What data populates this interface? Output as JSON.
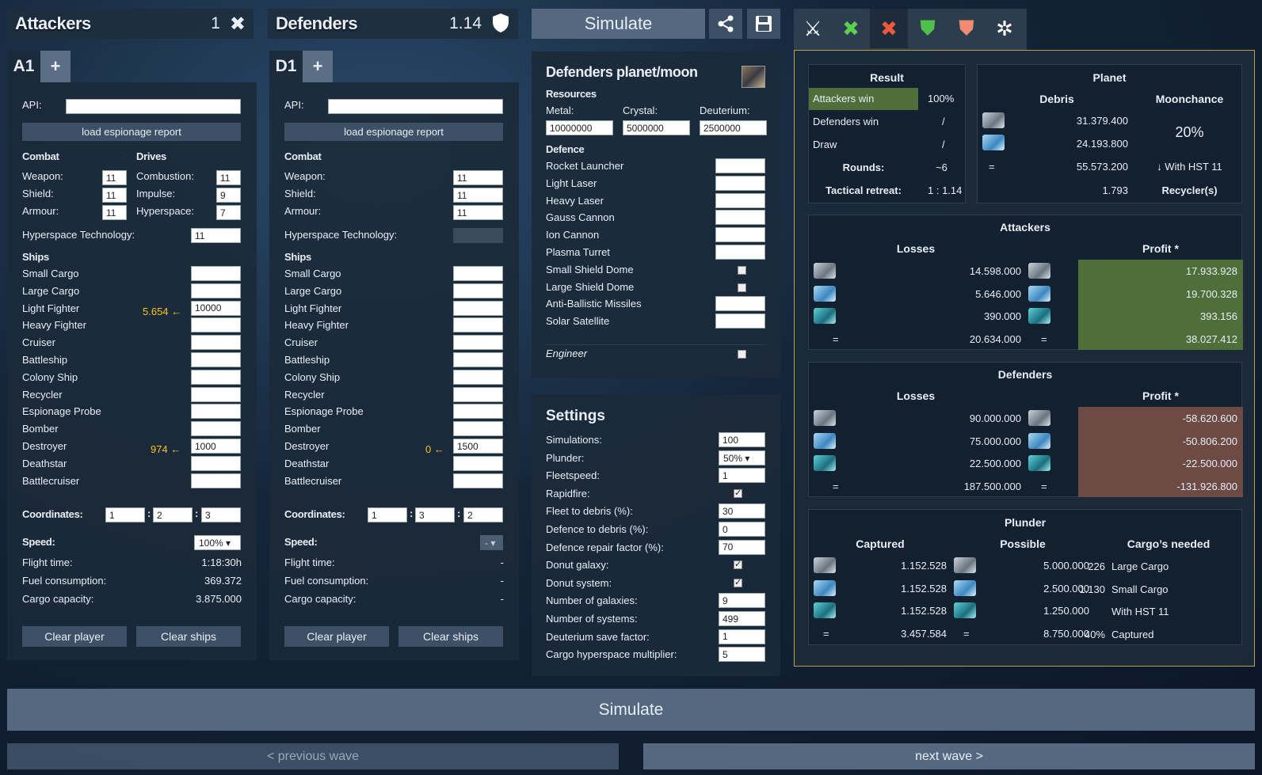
{
  "attackers": {
    "title": "Attackers",
    "value": "1",
    "tab": "A1",
    "api_label": "API:",
    "load_label": "load espionage report",
    "combat": "Combat",
    "drives": "Drives",
    "weapon": "Weapon:",
    "shield": "Shield:",
    "armour": "Armour:",
    "weapon_v": "11",
    "shield_v": "11",
    "armour_v": "11",
    "combustion": "Combustion:",
    "impulse": "Impulse:",
    "hyperspace": "Hyperspace:",
    "combustion_v": "11",
    "impulse_v": "9",
    "hyperspace_v": "7",
    "hst": "Hyperspace Technology:",
    "hst_v": "11",
    "ships": "Ships",
    "lf_hint": "5.654 ←",
    "lf_v": "10000",
    "ds_hint": "974 ←",
    "ds_v": "1000",
    "coords": "Coordinates:",
    "c1": "1",
    "c2": "2",
    "c3": "3",
    "speed": "Speed:",
    "speed_v": "100%",
    "flight": "Flight time:",
    "flight_v": "1:18:30h",
    "fuel": "Fuel consumption:",
    "fuel_v": "369.372",
    "cargo": "Cargo capacity:",
    "cargo_v": "3.875.000",
    "clear_player": "Clear player",
    "clear_ships": "Clear ships"
  },
  "defenders": {
    "title": "Defenders",
    "value": "1.14",
    "tab": "D1",
    "api_label": "API:",
    "load_label": "load espionage report",
    "combat": "Combat",
    "weapon": "Weapon:",
    "shield": "Shield:",
    "armour": "Armour:",
    "weapon_v": "11",
    "shield_v": "11",
    "armour_v": "11",
    "hst": "Hyperspace Technology:",
    "ships": "Ships",
    "ds_hint": "0 ←",
    "ds_v": "1500",
    "coords": "Coordinates:",
    "c1": "1",
    "c2": "3",
    "c3": "2",
    "speed": "Speed:",
    "speed_v": "-",
    "flight": "Flight time:",
    "flight_v": "-",
    "fuel": "Fuel consumption:",
    "fuel_v": "-",
    "cargo": "Cargo capacity:",
    "cargo_v": "-",
    "clear_player": "Clear player",
    "clear_ships": "Clear ships"
  },
  "ships": [
    "Small Cargo",
    "Large Cargo",
    "Light Fighter",
    "Heavy Fighter",
    "Cruiser",
    "Battleship",
    "Colony Ship",
    "Recycler",
    "Espionage Probe",
    "Bomber",
    "Destroyer",
    "Deathstar",
    "Battlecruiser"
  ],
  "top": {
    "simulate": "Simulate"
  },
  "planet": {
    "title": "Defenders planet/moon",
    "resources": "Resources",
    "metal": "Metal:",
    "crystal": "Crystal:",
    "deuterium": "Deuterium:",
    "metal_v": "10000000",
    "crystal_v": "5000000",
    "deut_v": "2500000",
    "defence": "Defence",
    "items": [
      "Rocket Launcher",
      "Light Laser",
      "Heavy Laser",
      "Gauss Cannon",
      "Ion Cannon",
      "Plasma Turret",
      "Small Shield Dome",
      "Large Shield Dome",
      "Anti-Ballistic Missiles",
      "Solar Satellite"
    ],
    "engineer": "Engineer"
  },
  "settings": {
    "title": "Settings",
    "rows": [
      {
        "label": "Simulations:",
        "value": "100"
      },
      {
        "label": "Plunder:",
        "value": "50%"
      },
      {
        "label": "Fleetspeed:",
        "value": "1"
      },
      {
        "label": "Rapidfire:",
        "value": ""
      },
      {
        "label": "Fleet to debris (%):",
        "value": "30"
      },
      {
        "label": "Defence to debris (%):",
        "value": "0"
      },
      {
        "label": "Defence repair factor (%):",
        "value": "70"
      },
      {
        "label": "Donut galaxy:",
        "value": ""
      },
      {
        "label": "Donut system:",
        "value": ""
      },
      {
        "label": "Number of galaxies:",
        "value": "9"
      },
      {
        "label": "Number of systems:",
        "value": "499"
      },
      {
        "label": "Deuterium save factor:",
        "value": "1"
      },
      {
        "label": "Cargo hyperspace multiplier:",
        "value": "5"
      }
    ]
  },
  "result": {
    "title": "Result",
    "att_win": "Attackers win",
    "att_win_v": "100%",
    "def_win": "Defenders win",
    "def_win_v": "/",
    "draw": "Draw",
    "draw_v": "/",
    "rounds": "Rounds:",
    "rounds_v": "~6",
    "retreat": "Tactical retreat:",
    "retreat_v": "1 : 1.14"
  },
  "planet_res": {
    "title": "Planet",
    "debris": "Debris",
    "moonchance": "Moonchance",
    "metal": "31.379.400",
    "crystal": "24.193.800",
    "eq": "=",
    "total": "55.573.200",
    "moon_v": "20%",
    "hst": "↓ With HST 11",
    "recyclers_n": "1.793",
    "recyclers": "Recycler(s)"
  },
  "att_res": {
    "title": "Attackers",
    "losses": "Losses",
    "profit": "Profit *",
    "l": [
      "14.598.000",
      "5.646.000",
      "390.000",
      "20.634.000"
    ],
    "p": [
      "17.933.928",
      "19.700.328",
      "393.156",
      "38.027.412"
    ],
    "eq": "="
  },
  "def_res": {
    "title": "Defenders",
    "losses": "Losses",
    "profit": "Profit *",
    "l": [
      "90.000.000",
      "75.000.000",
      "22.500.000",
      "187.500.000"
    ],
    "p": [
      "-58.620.600",
      "-50.806.200",
      "-22.500.000",
      "-131.926.800"
    ],
    "eq": "="
  },
  "plunder": {
    "title": "Plunder",
    "captured": "Captured",
    "possible": "Possible",
    "cargos": "Cargo’s needed",
    "cap": [
      "1.152.528",
      "1.152.528",
      "1.152.528",
      "3.457.584"
    ],
    "pos": [
      "5.000.000",
      "2.500.000",
      "1.250.000",
      "8.750.000"
    ],
    "n1": "226",
    "t1": "Large Cargo",
    "n2": "1.130",
    "t2": "Small Cargo",
    "t3": "With HST 11",
    "n4": "40%",
    "t4": "Captured",
    "eq": "="
  },
  "bottom": {
    "simulate": "Simulate",
    "prev": "< previous wave",
    "next": "next wave >"
  },
  "colors": {
    "win_green": "#4e6f3a",
    "loss_red": "#6e4a45",
    "accent_gold": "#f5c518"
  }
}
